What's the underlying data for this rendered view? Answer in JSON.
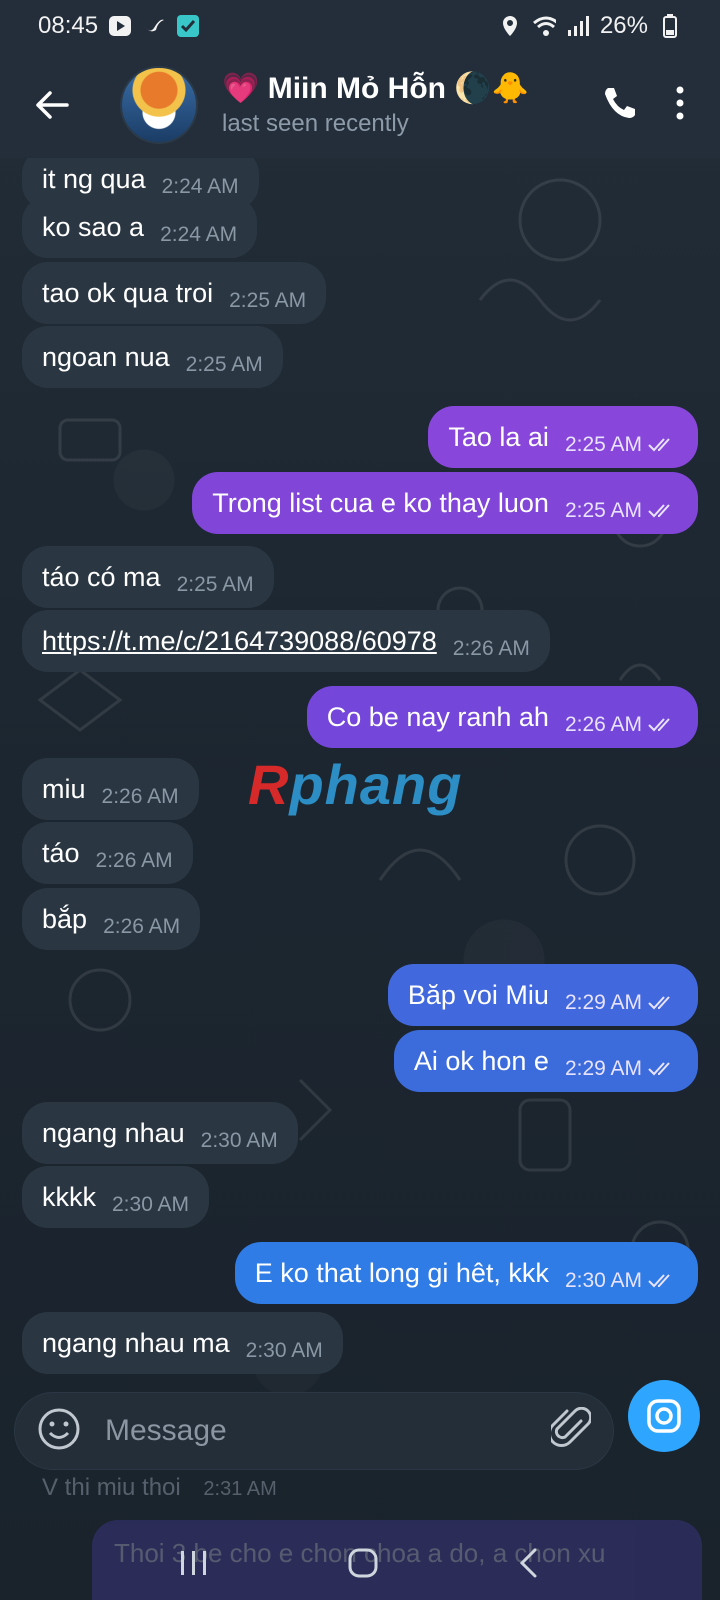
{
  "status_bar": {
    "time": "08:45",
    "battery": "26%",
    "icons": [
      "play-icon",
      "bird-icon",
      "check-app-icon",
      "location-icon",
      "wifi-icon",
      "signal-icon",
      "battery-icon"
    ]
  },
  "header": {
    "title_prefix": "💗",
    "title": "Miin Mỏ Hỗn",
    "title_suffix": "🌘🐥",
    "subtitle": "last seen recently"
  },
  "colors": {
    "background": "#1c2530",
    "incoming_bubble": "#2a3642",
    "accent_blue": "#2ea6ff",
    "gradient_purple": "#8a45d8",
    "gradient_blue": "#2e80e8"
  },
  "messages": [
    {
      "dir": "in",
      "text": "it ng qua",
      "time": "2:24 AM"
    },
    {
      "dir": "in",
      "text": "ko sao a",
      "time": "2:24 AM"
    },
    {
      "dir": "in",
      "text": "tao ok qua troi",
      "time": "2:25 AM"
    },
    {
      "dir": "in",
      "text": "ngoan nua",
      "time": "2:25 AM"
    },
    {
      "dir": "out",
      "text": "Tao la ai",
      "time": "2:25 AM"
    },
    {
      "dir": "out",
      "text": "Trong list cua e ko thay luon",
      "time": "2:25 AM"
    },
    {
      "dir": "in",
      "text": "táo có ma",
      "time": "2:25 AM"
    },
    {
      "dir": "in",
      "text": "https://t.me/c/2164739088/60978",
      "time": "2:26 AM",
      "link": true
    },
    {
      "dir": "out",
      "text": "Co be nay ranh ah",
      "time": "2:26 AM"
    },
    {
      "dir": "in",
      "text": "miu",
      "time": "2:26 AM"
    },
    {
      "dir": "in",
      "text": "táo",
      "time": "2:26 AM"
    },
    {
      "dir": "in",
      "text": "bắp",
      "time": "2:26 AM"
    },
    {
      "dir": "out",
      "text": "Băp voi Miu",
      "time": "2:29 AM"
    },
    {
      "dir": "out",
      "text": "Ai ok hon e",
      "time": "2:29 AM"
    },
    {
      "dir": "in",
      "text": "ngang nhau",
      "time": "2:30 AM"
    },
    {
      "dir": "in",
      "text": "kkkk",
      "time": "2:30 AM"
    },
    {
      "dir": "out",
      "text": "E ko that long gi hêt, kkk",
      "time": "2:30 AM"
    },
    {
      "dir": "in",
      "text": "ngang nhau ma",
      "time": "2:30 AM"
    }
  ],
  "watermark": {
    "first": "R",
    "rest": "phang"
  },
  "composer": {
    "placeholder": "Message",
    "under_text": "V thi miu thoi",
    "under_time": "2:31 AM",
    "under_bubble_text": "Thoi 3 be cho e chon choa a do, a chon xu"
  }
}
